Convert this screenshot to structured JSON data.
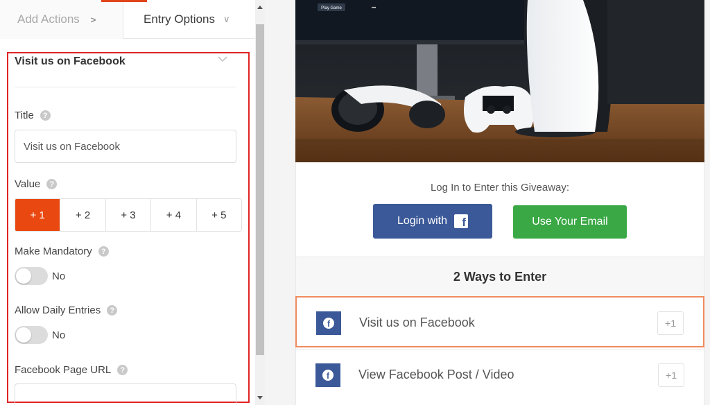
{
  "tabs": {
    "add_actions": "Add Actions",
    "entry_options": "Entry Options"
  },
  "editor": {
    "section_title": "Visit us on Facebook",
    "title_label": "Title",
    "title_value": "Visit us on Facebook",
    "value_label": "Value",
    "value_options": [
      "+ 1",
      "+ 2",
      "+ 3",
      "+ 4",
      "+ 5"
    ],
    "value_selected": "+ 1",
    "mandatory_label": "Make Mandatory",
    "mandatory_state": "No",
    "daily_label": "Allow Daily Entries",
    "daily_state": "No",
    "fb_url_label": "Facebook Page URL",
    "fb_url_value": ""
  },
  "preview": {
    "hero_badge": "Play Game",
    "hero_dots": "•••",
    "login_title": "Log In to Enter this Giveaway:",
    "login_facebook": "Login with",
    "login_email": "Use Your Email",
    "ways_title": "2 Ways to Enter",
    "entries": [
      {
        "label": "Visit us on Facebook",
        "points": "+1"
      },
      {
        "label": "View Facebook Post / Video",
        "points": "+1"
      }
    ]
  },
  "colors": {
    "accent": "#ea4811",
    "highlight": "#e02424",
    "facebook": "#3b5998",
    "email": "#3aa845",
    "selected_entry": "#f08a5d"
  }
}
